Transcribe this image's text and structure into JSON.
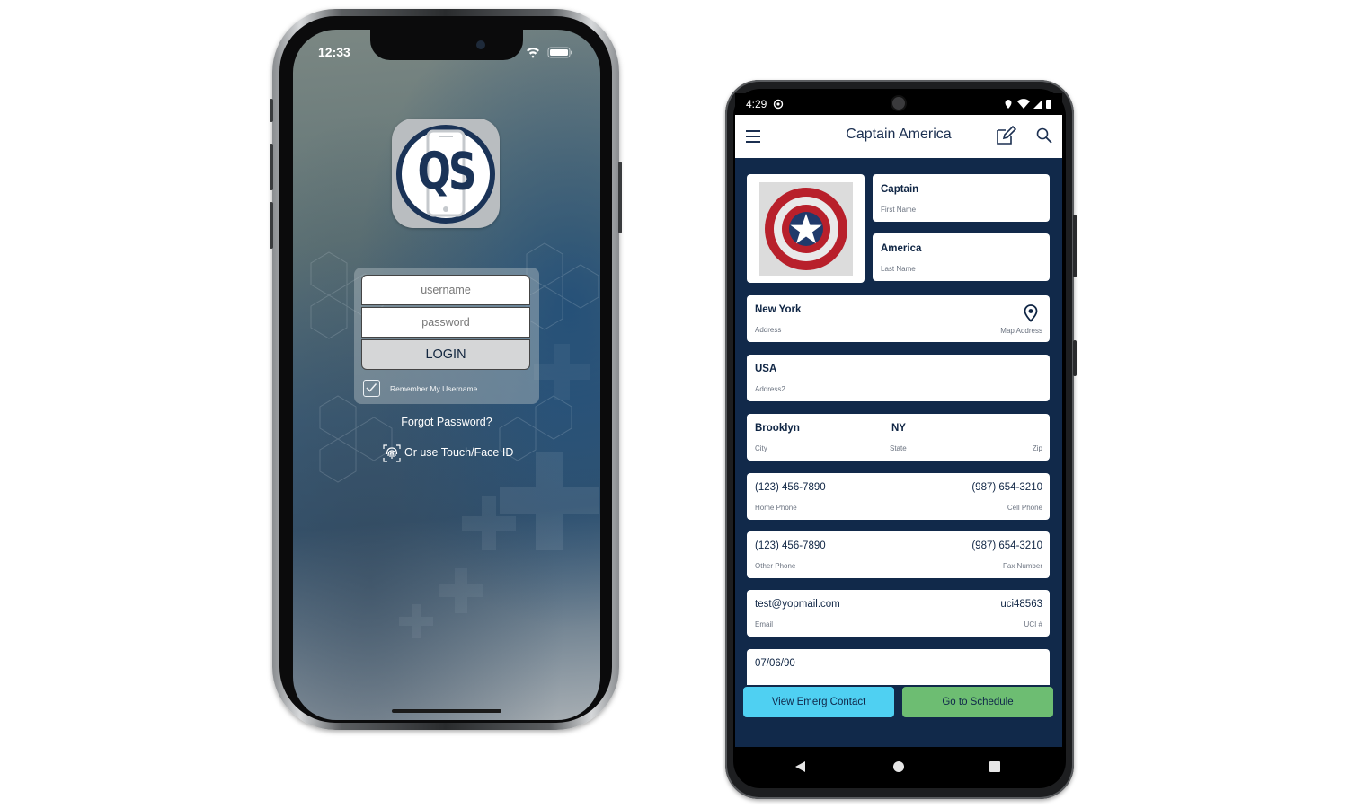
{
  "iphone": {
    "status_time": "12:33",
    "app_logo_text": "QS",
    "login": {
      "username_placeholder": "username",
      "password_placeholder": "password",
      "login_label": "LOGIN",
      "remember_label": "Remember My Username",
      "remember_checked": true
    },
    "forgot_label": "Forgot Password?",
    "touch_label": "Or use Touch/Face ID"
  },
  "android": {
    "status_time": "4:29",
    "toolbar": {
      "title": "Captain America",
      "menu_icon": "hamburger-icon",
      "edit_icon": "edit-icon",
      "search_icon": "search-icon"
    },
    "contact": {
      "first_name": {
        "value": "Captain",
        "label": "First Name"
      },
      "last_name": {
        "value": "America",
        "label": "Last Name"
      },
      "address": {
        "value": "New York",
        "label": "Address",
        "map_label": "Map Address"
      },
      "address2": {
        "value": "USA",
        "label": "Address2"
      },
      "city": {
        "value": "Brooklyn",
        "label": "City"
      },
      "state": {
        "value": "NY",
        "label": "State"
      },
      "zip": {
        "value": "",
        "label": "Zip"
      },
      "home_phone": {
        "value": "(123) 456-7890",
        "label": "Home Phone"
      },
      "cell_phone": {
        "value": "(987) 654-3210",
        "label": "Cell Phone"
      },
      "other_phone": {
        "value": "(123) 456-7890",
        "label": "Other Phone"
      },
      "fax": {
        "value": "(987) 654-3210",
        "label": "Fax Number"
      },
      "email": {
        "value": "test@yopmail.com",
        "label": "Email"
      },
      "uci": {
        "value": "uci48563",
        "label": "UCI #"
      },
      "dob": {
        "value": "07/06/90"
      }
    },
    "buttons": {
      "emerg": "View Emerg Contact",
      "schedule": "Go to Schedule"
    },
    "colors": {
      "background": "#11294a",
      "emerg_button": "#4fd0f2",
      "schedule_button": "#6dbd72"
    }
  }
}
